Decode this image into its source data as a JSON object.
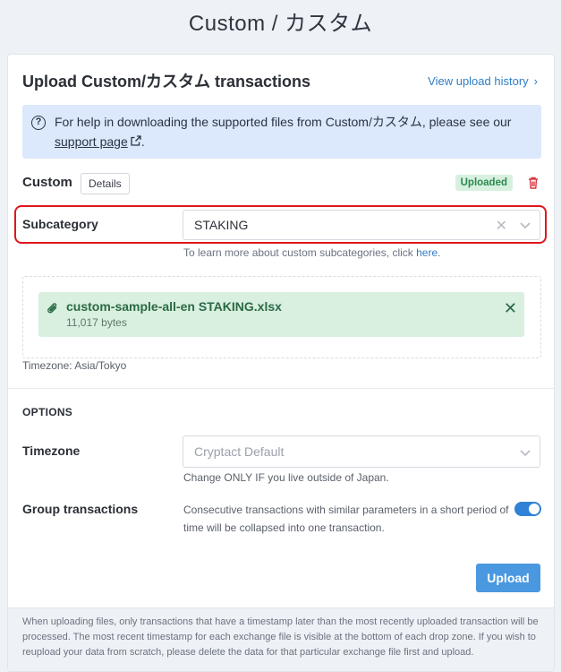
{
  "page": {
    "title": "Custom / カスタム"
  },
  "card": {
    "title": "Upload Custom/カスタム transactions",
    "history_link": "View upload history"
  },
  "info": {
    "text_before": "For help in downloading the supported files from Custom/カスタム, please see our ",
    "link_text": "support page",
    "text_after": "."
  },
  "exchange": {
    "name": "Custom",
    "details_label": "Details",
    "status_badge": "Uploaded"
  },
  "subcategory": {
    "label": "Subcategory",
    "value": "STAKING",
    "help_before": "To learn more about custom subcategories, click ",
    "help_link": "here",
    "help_after": "."
  },
  "file": {
    "name": "custom-sample-all-en STAKING.xlsx",
    "size": "11,017 bytes"
  },
  "timezone_note": "Timezone: Asia/Tokyo",
  "options": {
    "heading": "OPTIONS",
    "timezone": {
      "label": "Timezone",
      "placeholder": "Cryptact Default",
      "help": "Change ONLY IF you live outside of Japan."
    },
    "group": {
      "label": "Group transactions",
      "description": "Consecutive transactions with similar parameters in a short period of time will be collapsed into one transaction.",
      "enabled": true
    }
  },
  "upload_button": "Upload",
  "footer_note": "When uploading files, only transactions that have a timestamp later than the most recently uploaded transaction will be processed. The most recent timestamp for each exchange file is visible at the bottom of each drop zone. If you wish to reupload your data from scratch, please delete the data for that particular exchange file first and upload.",
  "colors": {
    "accent": "#2f7ec4",
    "upload_button": "#4a98e0",
    "highlight_border": "#e0161d",
    "info_background": "#dce8fb",
    "file_chip_background": "#d9efe0",
    "badge_text": "#2a8a4e"
  }
}
